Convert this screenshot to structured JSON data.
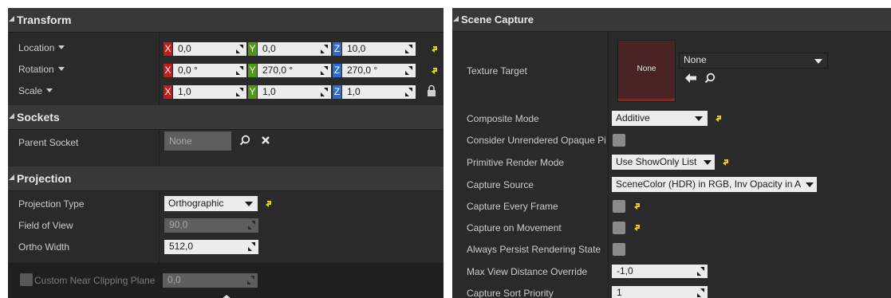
{
  "left": {
    "transform": {
      "title": "Transform",
      "location": {
        "label": "Location",
        "x": "0,0",
        "y": "0,0",
        "z": "10,0"
      },
      "rotation": {
        "label": "Rotation",
        "x": "0,0 °",
        "y": "270,0 °",
        "z": "270,0 °"
      },
      "scale": {
        "label": "Scale",
        "x": "1,0",
        "y": "1,0",
        "z": "1,0"
      },
      "axis_x": "X",
      "axis_y": "Y",
      "axis_z": "Z"
    },
    "sockets": {
      "title": "Sockets",
      "parent_socket_label": "Parent Socket",
      "parent_socket_value": "None"
    },
    "projection": {
      "title": "Projection",
      "projection_type_label": "Projection Type",
      "projection_type_value": "Orthographic",
      "fov_label": "Field of View",
      "fov_value": "90,0",
      "ortho_width_label": "Ortho Width",
      "ortho_width_value": "512,0",
      "near_clip_label": "Custom Near Clipping Plane",
      "near_clip_value": "0,0"
    }
  },
  "right": {
    "scene_capture": {
      "title": "Scene Capture",
      "texture_target_label": "Texture Target",
      "texture_thumb_text": "None",
      "texture_combo_value": "None",
      "composite_mode_label": "Composite Mode",
      "composite_mode_value": "Additive",
      "consider_unrendered_label": "Consider Unrendered Opaque Pi",
      "primitive_render_mode_label": "Primitive Render Mode",
      "primitive_render_mode_value": "Use ShowOnly List",
      "capture_source_label": "Capture Source",
      "capture_source_value": "SceneColor (HDR) in RGB, Inv Opacity in A",
      "capture_every_frame_label": "Capture Every Frame",
      "capture_on_movement_label": "Capture on Movement",
      "always_persist_label": "Always Persist Rendering State",
      "max_view_distance_label": "Max View Distance Override",
      "max_view_distance_value": "-1,0",
      "capture_sort_priority_label": "Capture Sort Priority",
      "capture_sort_priority_value": "1"
    }
  },
  "colors": {
    "panel_bg": "#2a2a2a",
    "category_bg": "#383838",
    "axis_x": "#c41c1c",
    "axis_y": "#4f9a12",
    "axis_z": "#2b6bd6",
    "reset_arrow": "#e8d400",
    "texture_thumb": "#4a2424"
  },
  "icons": [
    "search-icon",
    "clear-icon",
    "lock-icon",
    "use-selected-arrow-icon",
    "reset-to-default-icon",
    "dropdown-arrow-icon",
    "category-collapse-icon"
  ]
}
